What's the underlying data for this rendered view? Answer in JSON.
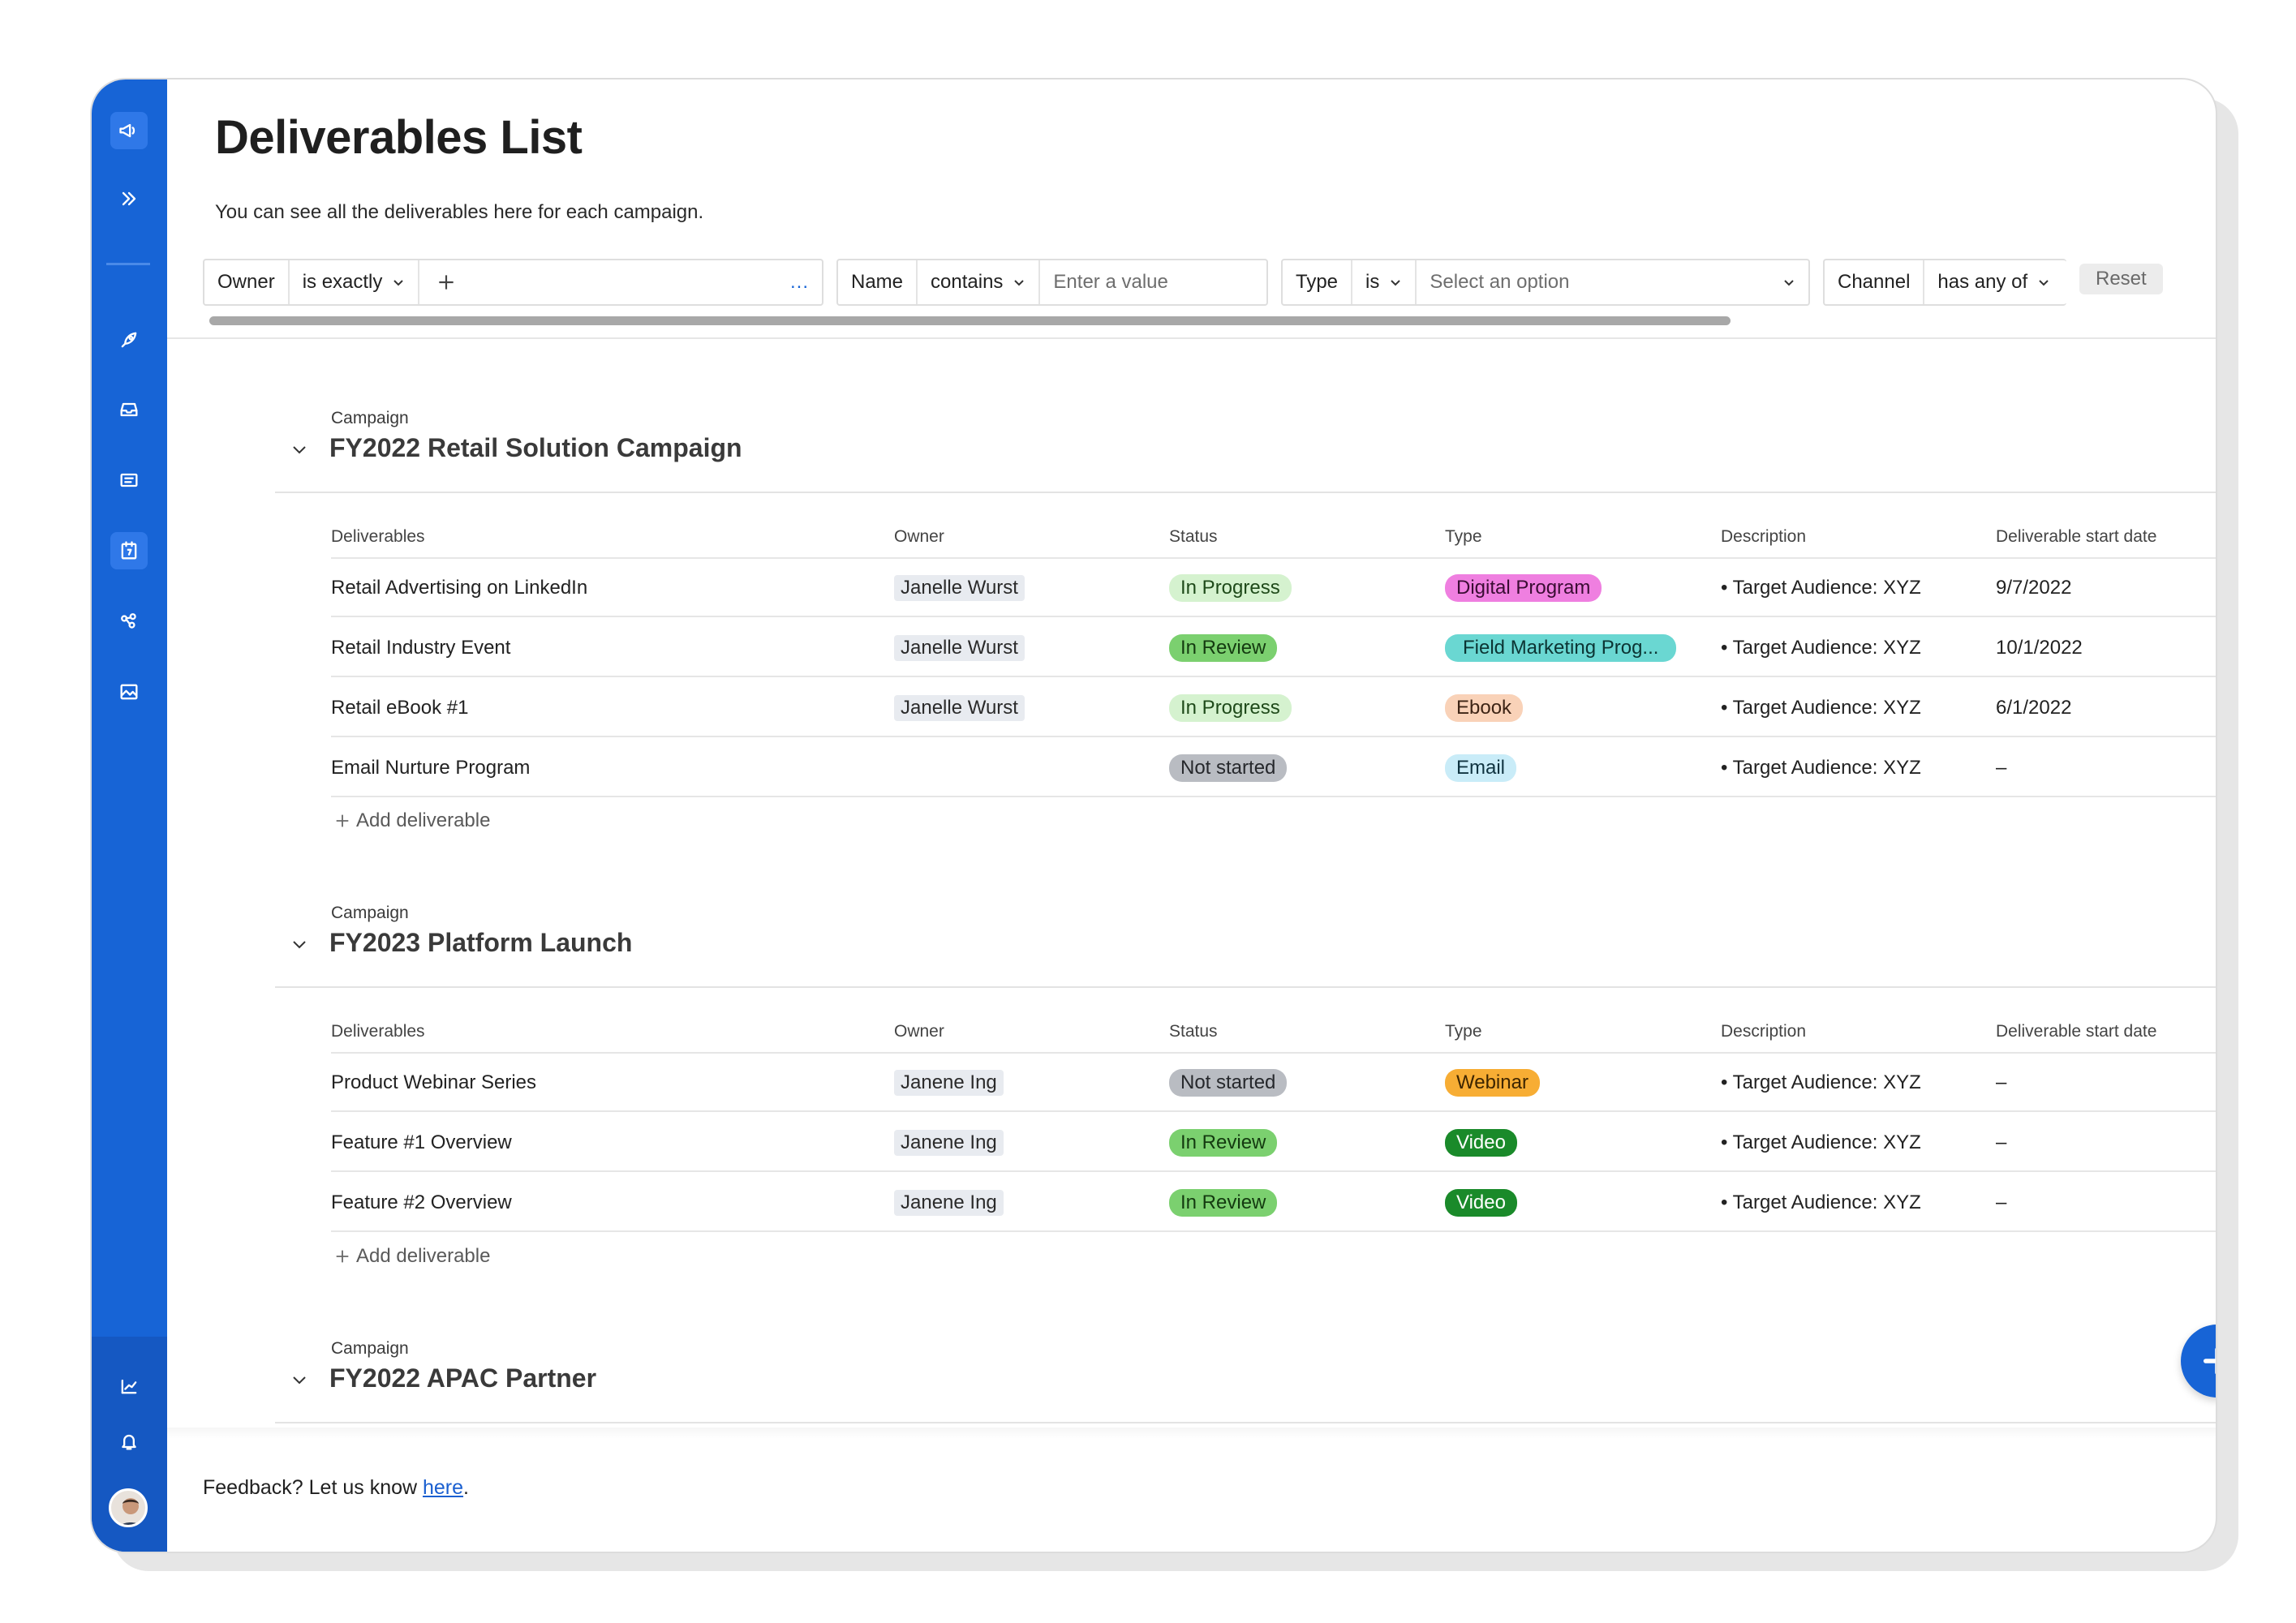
{
  "page": {
    "title": "Deliverables List",
    "subtitle": "You can see all the deliverables here for each campaign."
  },
  "filters": {
    "owner": {
      "field": "Owner",
      "operator": "is exactly",
      "more": "..."
    },
    "name": {
      "field": "Name",
      "operator": "contains",
      "placeholder": "Enter a value"
    },
    "type": {
      "field": "Type",
      "operator": "is",
      "placeholder": "Select an option"
    },
    "channel": {
      "field": "Channel",
      "operator": "has any of"
    },
    "reset_label": "Reset"
  },
  "columns": {
    "deliverables": "Deliverables",
    "owner": "Owner",
    "status": "Status",
    "type": "Type",
    "description": "Description",
    "start_date": "Deliverable start date"
  },
  "campaign_label": "Campaign",
  "add_deliverable_label": "Add deliverable",
  "campaigns": [
    {
      "title": "FY2022 Retail Solution Campaign",
      "rows": [
        {
          "name": "Retail Advertising on LinkedIn",
          "owner": "Janelle Wurst",
          "status": "In Progress",
          "type": "Digital Program",
          "description": "• Target Audience: XYZ",
          "start_date": "9/7/2022"
        },
        {
          "name": "Retail Industry Event",
          "owner": "Janelle Wurst",
          "status": "In Review",
          "type": "Field Marketing Prog...",
          "description": "• Target Audience: XYZ",
          "start_date": "10/1/2022"
        },
        {
          "name": "Retail eBook #1",
          "owner": "Janelle Wurst",
          "status": "In Progress",
          "type": "Ebook",
          "description": "• Target Audience: XYZ",
          "start_date": "6/1/2022"
        },
        {
          "name": "Email Nurture Program",
          "owner": "",
          "status": "Not started",
          "type": "Email",
          "description": "• Target Audience: XYZ",
          "start_date": "–"
        }
      ]
    },
    {
      "title": "FY2023 Platform Launch",
      "rows": [
        {
          "name": "Product Webinar Series",
          "owner": "Janene Ing",
          "status": "Not started",
          "type": "Webinar",
          "description": "• Target Audience: XYZ",
          "start_date": "–"
        },
        {
          "name": "Feature #1 Overview",
          "owner": "Janene Ing",
          "status": "In Review",
          "type": "Video",
          "description": "• Target Audience: XYZ",
          "start_date": "–"
        },
        {
          "name": "Feature #2 Overview",
          "owner": "Janene Ing",
          "status": "In Review",
          "type": "Video",
          "description": "• Target Audience: XYZ",
          "start_date": "–"
        }
      ]
    },
    {
      "title": "FY2022 APAC Partner",
      "rows": []
    }
  ],
  "footer": {
    "prefix": "Feedback? Let us know ",
    "link": "here",
    "suffix": "."
  },
  "colors": {
    "sidebar": "#1764d6",
    "status_in_progress": "#d5f2cf",
    "status_in_review": "#7bd06f",
    "status_not_started": "#b9bcc2",
    "type_digital_program": "#ef7fe0",
    "type_field_marketing": "#6ad7d2",
    "type_ebook": "#f9d2b8",
    "type_email": "#c9ecf8",
    "type_webinar": "#f7ad34",
    "type_video": "#1a8a2a"
  },
  "icons": {
    "sidebar": [
      "megaphone-icon",
      "double-chevron-right-icon",
      "rocket-icon",
      "inbox-icon",
      "ticket-icon",
      "calendar-icon",
      "share-icon",
      "image-icon",
      "analytics-icon",
      "bell-icon"
    ]
  }
}
